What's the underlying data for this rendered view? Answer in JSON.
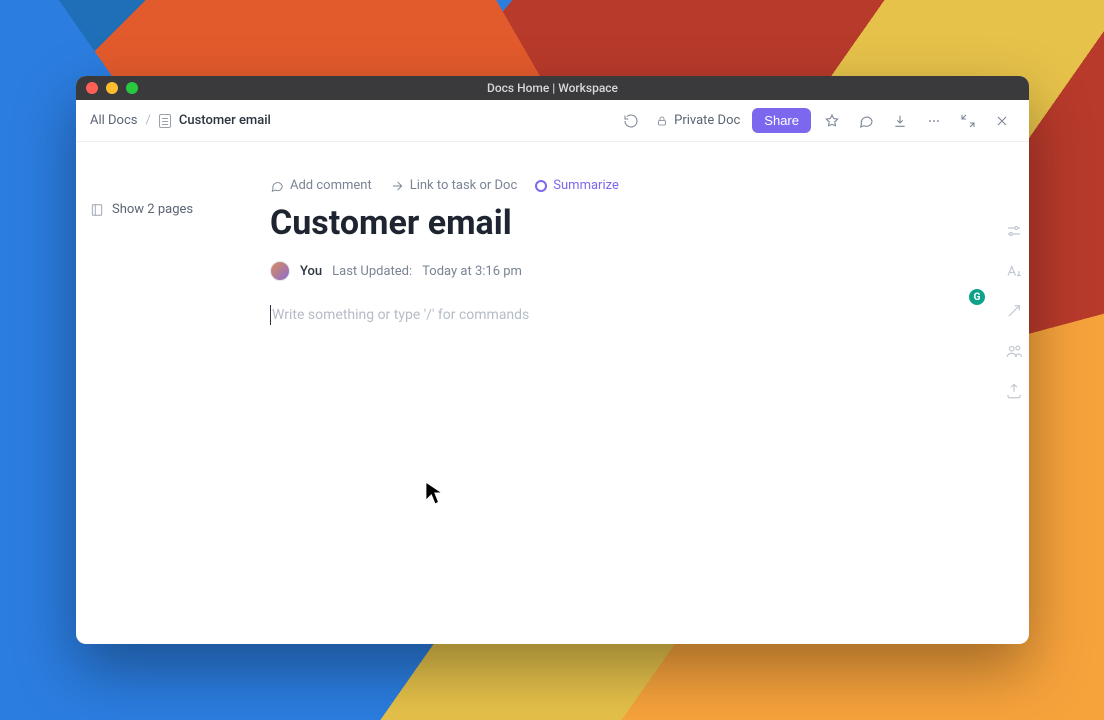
{
  "window": {
    "title": "Docs Home | Workspace"
  },
  "breadcrumb": {
    "root": "All Docs",
    "current": "Customer email"
  },
  "toolbar": {
    "private_label": "Private Doc",
    "share_label": "Share"
  },
  "sidebar": {
    "show_pages_label": "Show 2 pages"
  },
  "actions": {
    "add_comment": "Add comment",
    "link_task": "Link to task or Doc",
    "summarize": "Summarize"
  },
  "doc": {
    "title": "Customer email",
    "author_label": "You",
    "last_updated_prefix": "Last Updated:",
    "last_updated_value": "Today at 3:16 pm",
    "editor_placeholder": "Write something or type '/' for commands"
  },
  "grammarly_badge": "G"
}
